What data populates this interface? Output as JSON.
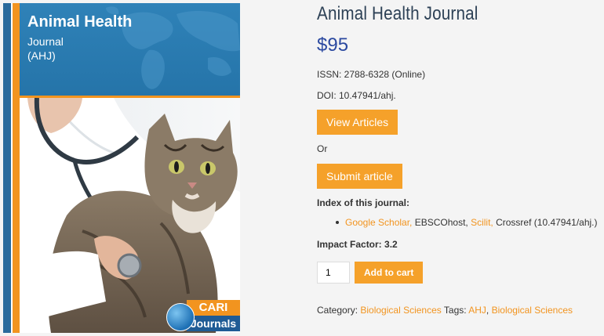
{
  "cover": {
    "title": "Animal Health",
    "subtitle_line1": "Journal",
    "subtitle_line2": "(AHJ)",
    "logo_top": "CARI",
    "logo_bottom": "Journals"
  },
  "product": {
    "title": "Animal Health Journal",
    "price": "$95",
    "issn": "ISSN: 2788-6328 (Online)",
    "doi": "DOI: 10.47941/ahj.",
    "view_articles_label": "View Articles",
    "or_text": "Or",
    "submit_article_label": "Submit article",
    "index_heading": "Index of this journal:",
    "index_items": [
      {
        "text": "Google Scholar,",
        "is_link": true
      },
      {
        "text": " EBSCOhost, ",
        "is_link": false
      },
      {
        "text": "Scilit,",
        "is_link": true
      },
      {
        "text": " Crossref (10.47941/ahj.)",
        "is_link": false
      }
    ],
    "impact_factor": "Impact Factor: 3.2",
    "quantity_value": "1",
    "add_to_cart_label": "Add to cart",
    "category_label": "Category:",
    "category_link": "Biological Sciences",
    "tags_label": "Tags:",
    "tag_1": "AHJ",
    "tag_separator": ",",
    "tag_2": "Biological Sciences"
  },
  "colors": {
    "accent_orange": "#f5a12a",
    "title_navy": "#2d4156",
    "price_blue": "#2b49a0",
    "cover_blue": "#2a6a9c"
  }
}
